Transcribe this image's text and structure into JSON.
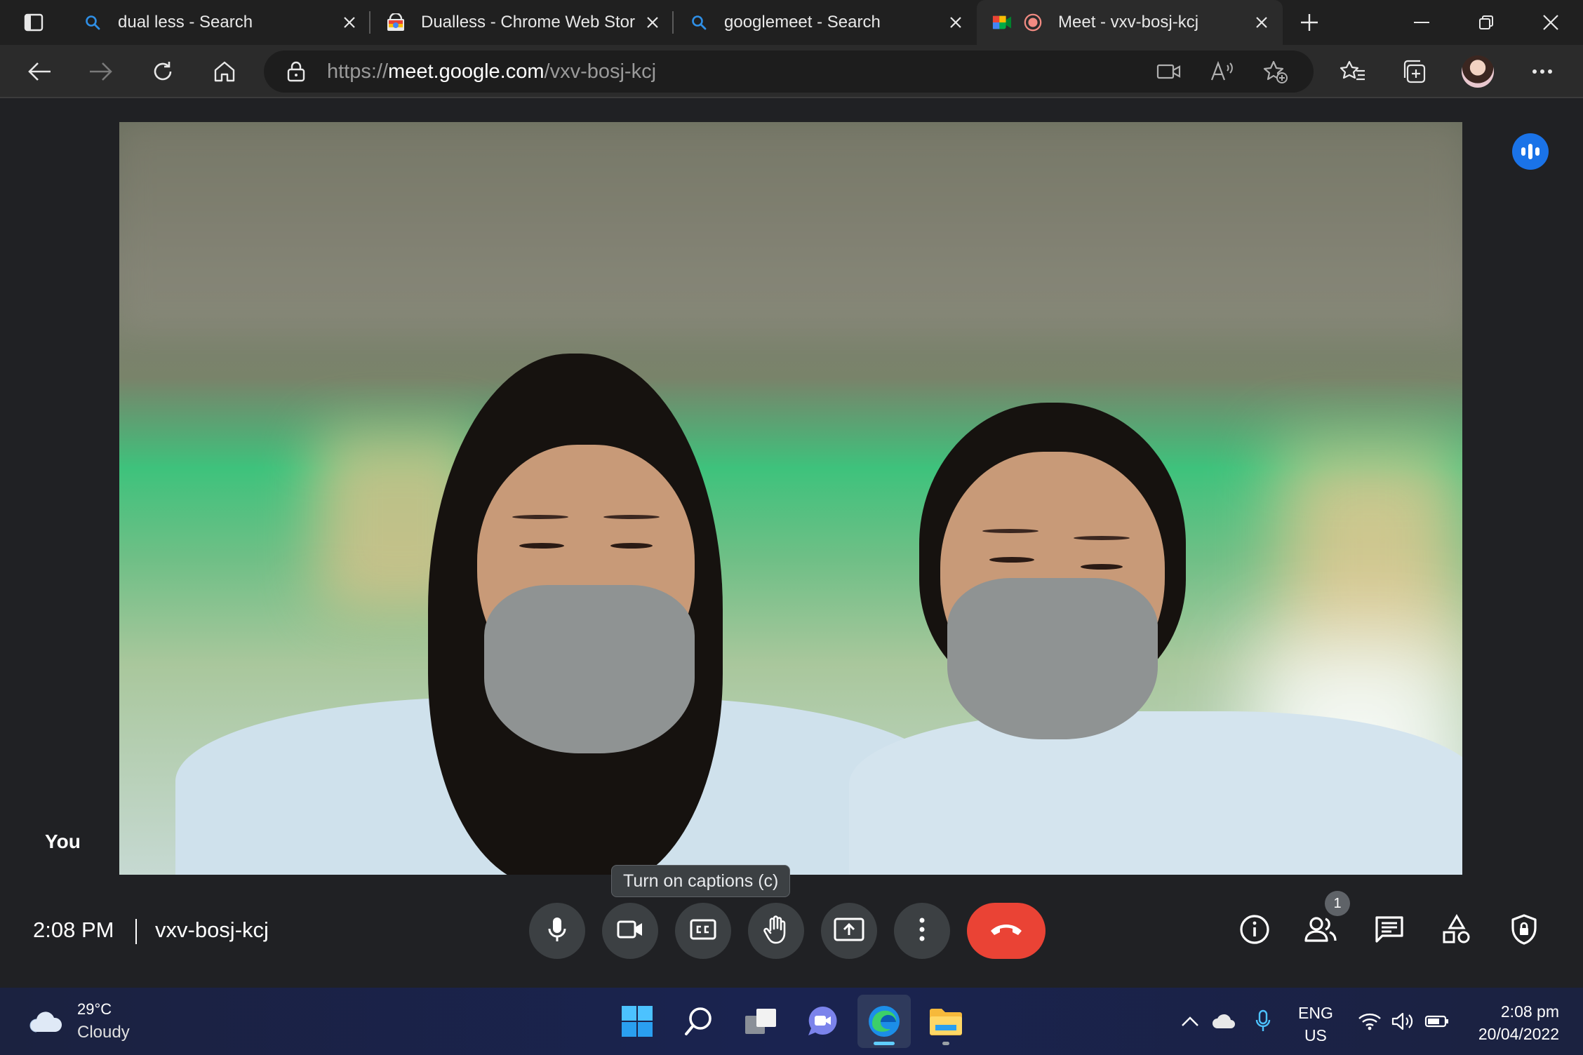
{
  "browser": {
    "tabs": [
      {
        "title": "dual less - Search",
        "icon": "search-icon"
      },
      {
        "title": "Dualless - Chrome Web Store",
        "icon": "chrome-web-store-icon"
      },
      {
        "title": "googlemeet - Search",
        "icon": "search-icon"
      },
      {
        "title": "Meet - vxv-bosj-kcj",
        "icon": "google-meet-icon",
        "active": true,
        "recording": true
      }
    ],
    "address": {
      "scheme": "https://",
      "host": "meet.google.com",
      "path": "/vxv-bosj-kcj"
    }
  },
  "meet": {
    "self_label": "You",
    "tooltip": "Turn on captions (c)",
    "time": "2:08 PM",
    "meeting_code": "vxv-bosj-kcj",
    "people_count": "1",
    "controls": [
      "mic-icon",
      "camera-icon",
      "captions-icon",
      "raise-hand-icon",
      "present-icon",
      "more-options-icon",
      "end-call-icon"
    ],
    "side_controls": [
      "info-icon",
      "people-icon",
      "chat-icon",
      "activities-icon",
      "host-controls-icon"
    ],
    "colors": {
      "end_call": "#ea4335",
      "speaking": "#1a73e8",
      "control_bg": "#3c4043",
      "background": "#202124"
    }
  },
  "taskbar": {
    "weather_temp": "29°C",
    "weather_desc": "Cloudy",
    "lang_line1": "ENG",
    "lang_line2": "US",
    "clock_time": "2:08 pm",
    "clock_date": "20/04/2022"
  }
}
